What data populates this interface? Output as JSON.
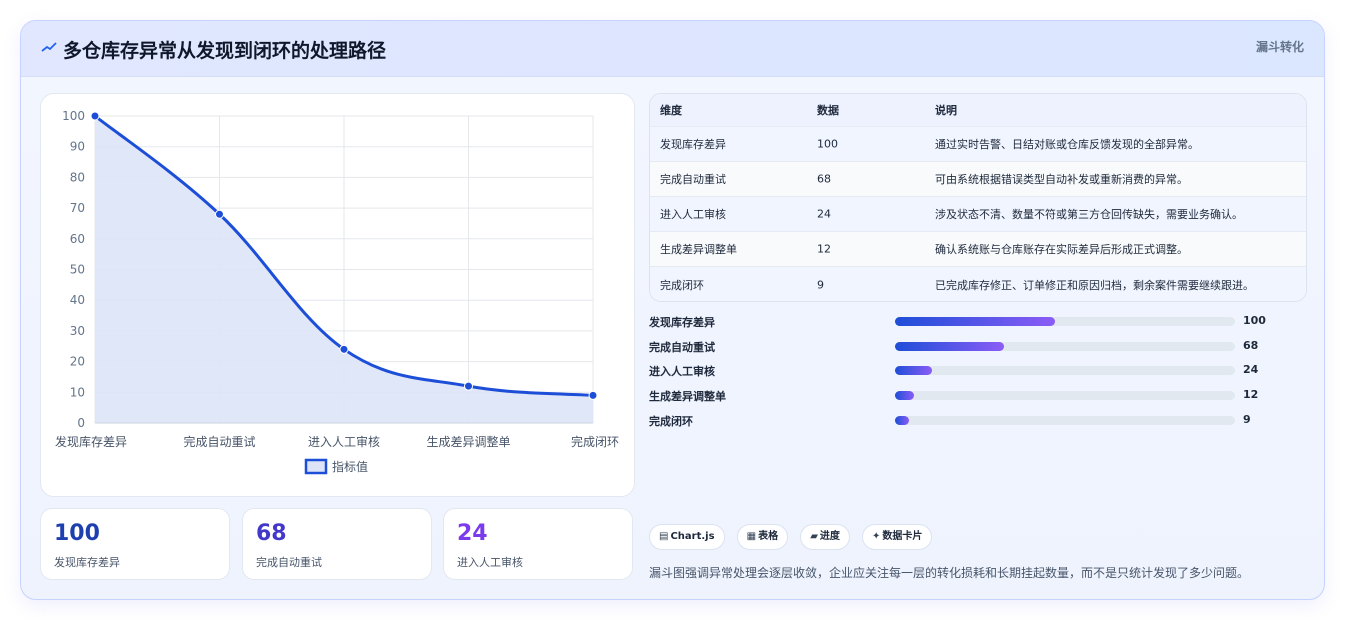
{
  "header": {
    "title": "多仓库存异常从发现到闭环的处理路径",
    "tag": "漏斗转化"
  },
  "colors": {
    "line": "#1d4ed8",
    "area": "#dde4f7",
    "accent_blue": "#1e40af",
    "accent_indigo": "#4338ca",
    "accent_purple": "#7c3aed"
  },
  "chart_data": {
    "type": "area",
    "categories": [
      "发现库存差异",
      "完成自动重试",
      "进入人工审核",
      "生成差异调整单",
      "完成闭环"
    ],
    "series": [
      {
        "name": "指标值",
        "values": [
          100,
          68,
          24,
          12,
          9
        ]
      }
    ],
    "ylim": [
      0,
      100
    ],
    "yticks": [
      0,
      10,
      20,
      30,
      40,
      50,
      60,
      70,
      80,
      90,
      100
    ],
    "grid": true,
    "legend": "bottom"
  },
  "stats": [
    {
      "value": "100",
      "label": "发现库存差异"
    },
    {
      "value": "68",
      "label": "完成自动重试"
    },
    {
      "value": "24",
      "label": "进入人工审核"
    }
  ],
  "table": {
    "headers": [
      "维度",
      "数据",
      "说明"
    ],
    "rows": [
      [
        "发现库存差异",
        "100",
        "通过实时告警、日结对账或仓库反馈发现的全部异常。"
      ],
      [
        "完成自动重试",
        "68",
        "可由系统根据错误类型自动补发或重新消费的异常。"
      ],
      [
        "进入人工审核",
        "24",
        "涉及状态不清、数量不符或第三方仓回传缺失，需要业务确认。"
      ],
      [
        "生成差异调整单",
        "12",
        "确认系统账与仓库账存在实际差异后形成正式调整。"
      ],
      [
        "完成闭环",
        "9",
        "已完成库存修正、订单修正和原因归档，剩余案件需要继续跟进。"
      ]
    ]
  },
  "progress": {
    "max": 100,
    "items": [
      {
        "label": "发现库存差异",
        "value": 100,
        "fill": 0.47
      },
      {
        "label": "完成自动重试",
        "value": 68,
        "fill": 0.32
      },
      {
        "label": "进入人工审核",
        "value": 24,
        "fill": 0.11
      },
      {
        "label": "生成差异调整单",
        "value": 12,
        "fill": 0.055
      },
      {
        "label": "完成闭环",
        "value": 9,
        "fill": 0.04
      }
    ]
  },
  "chips": [
    {
      "icon": "chart-icon",
      "label": "Chart.js"
    },
    {
      "icon": "table-icon",
      "label": "表格"
    },
    {
      "icon": "progress-icon",
      "label": "进度"
    },
    {
      "icon": "card-icon",
      "label": "数据卡片"
    }
  ],
  "note": "漏斗图强调异常处理会逐层收敛，企业应关注每一层的转化损耗和长期挂起数量，而不是只统计发现了多少问题。"
}
